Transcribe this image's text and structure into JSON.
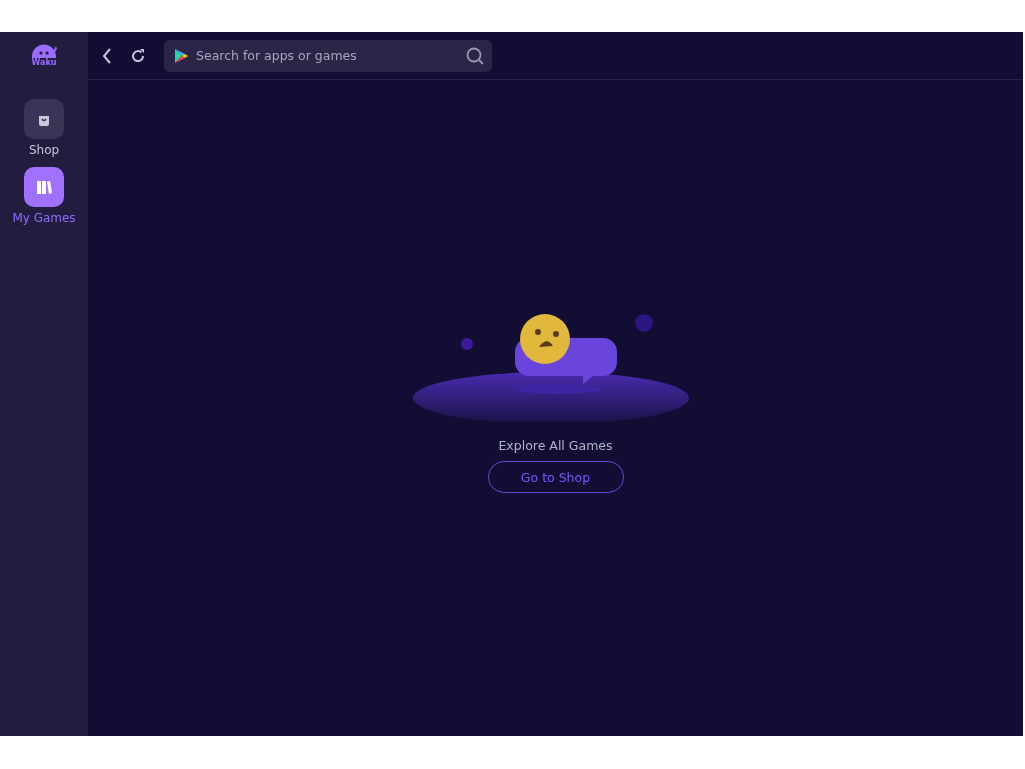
{
  "logo": {
    "text": "Waku"
  },
  "sidebar": {
    "items": [
      {
        "kind": "shop",
        "label": "Shop",
        "selected": false
      },
      {
        "kind": "games",
        "label": "My Games",
        "selected": true
      }
    ]
  },
  "search": {
    "placeholder": "Search for apps or games"
  },
  "empty_state": {
    "message": "Explore All Games",
    "button": "Go to Shop"
  }
}
